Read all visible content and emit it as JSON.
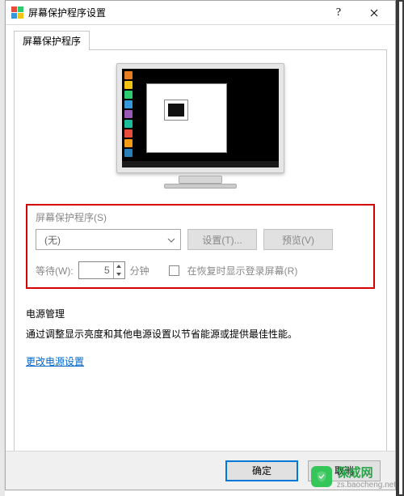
{
  "titlebar": {
    "title": "屏幕保护程序设置"
  },
  "tab": {
    "label": "屏幕保护程序"
  },
  "screensaver": {
    "section_label": "屏幕保护程序(S)",
    "selected": "(无)",
    "settings_btn": "设置(T)...",
    "preview_btn": "预览(V)",
    "wait_label": "等待(W):",
    "wait_value": "5",
    "wait_unit": "分钟",
    "resume_checkbox_label": "在恢复时显示登录屏幕(R)"
  },
  "power": {
    "section_label": "电源管理",
    "description": "通过调整显示亮度和其他电源设置以节省能源或提供最佳性能。",
    "link": "更改电源设置"
  },
  "buttons": {
    "ok": "确定",
    "cancel": "取消"
  },
  "watermark": {
    "brand": "保成网",
    "url": "zs.baocheng.net"
  }
}
